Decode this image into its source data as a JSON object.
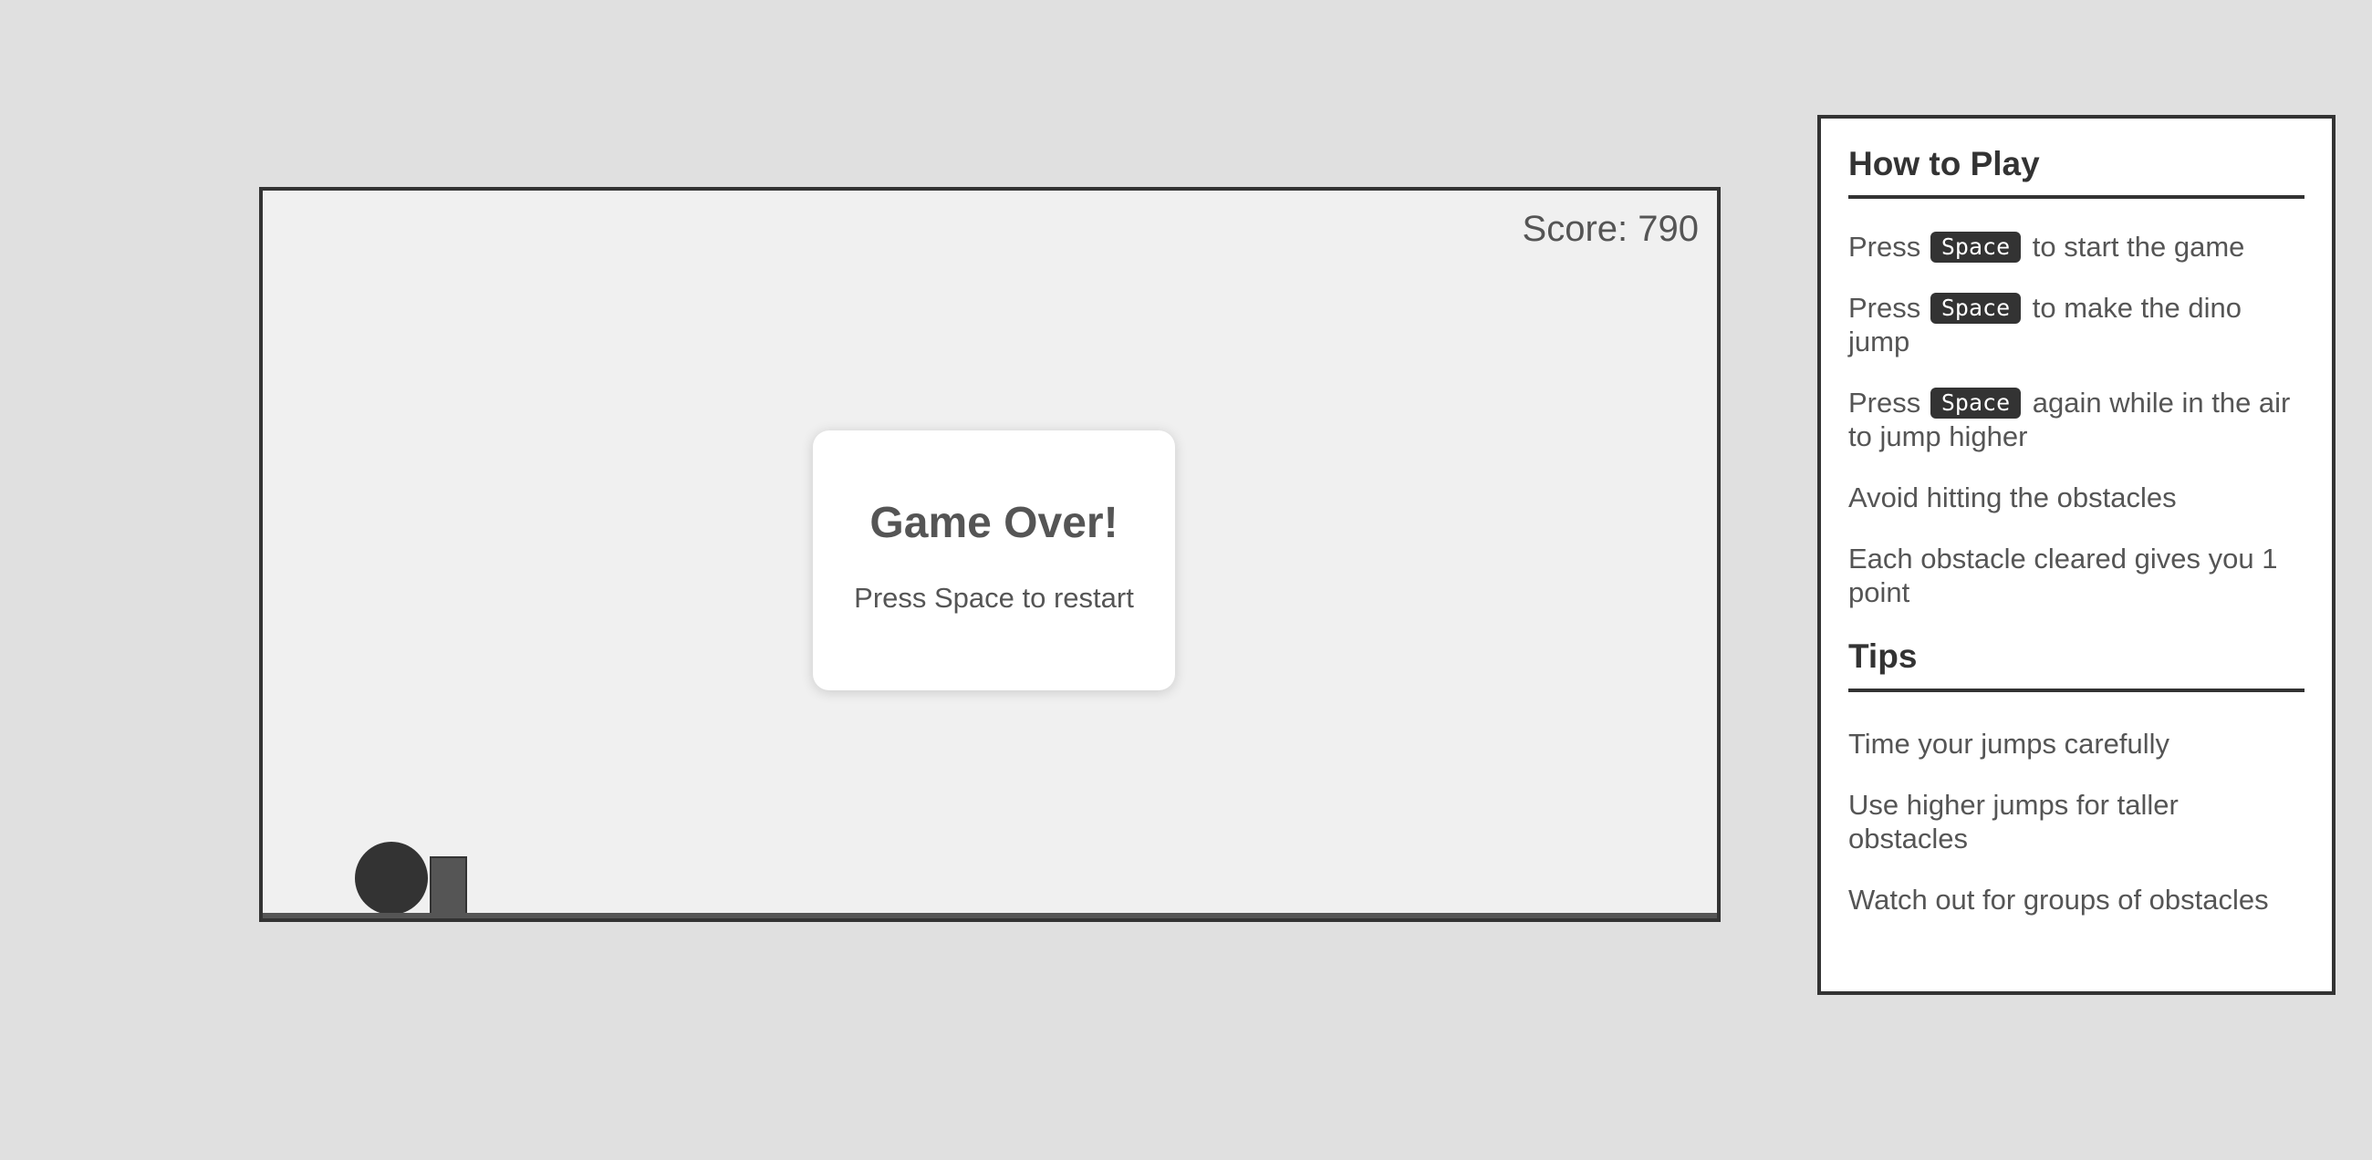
{
  "game": {
    "score_label": "Score: 790",
    "game_over": {
      "title": "Game Over!",
      "message": "Press Space to restart"
    }
  },
  "instructions": {
    "how_to_play": {
      "title": "How to Play",
      "items": [
        {
          "before": "Press",
          "key": "Space",
          "after": "to start the game"
        },
        {
          "before": "Press",
          "key": "Space",
          "after": "to make the dino jump"
        },
        {
          "before": "Press",
          "key": "Space",
          "after": "again while in the air to jump higher"
        },
        {
          "text": "Avoid hitting the obstacles"
        },
        {
          "text": "Each obstacle cleared gives you 1 point"
        }
      ]
    },
    "tips": {
      "title": "Tips",
      "items": [
        "Time your jumps carefully",
        "Use higher jumps for taller obstacles",
        "Watch out for groups of obstacles"
      ]
    }
  },
  "colors": {
    "page_background": "#e0e0e0",
    "game_background": "#f0f0f0",
    "border": "#333333",
    "dino": "#333333",
    "obstacle": "#555555",
    "text": "#555555",
    "key_background": "#333333",
    "key_text": "#ffffff"
  }
}
